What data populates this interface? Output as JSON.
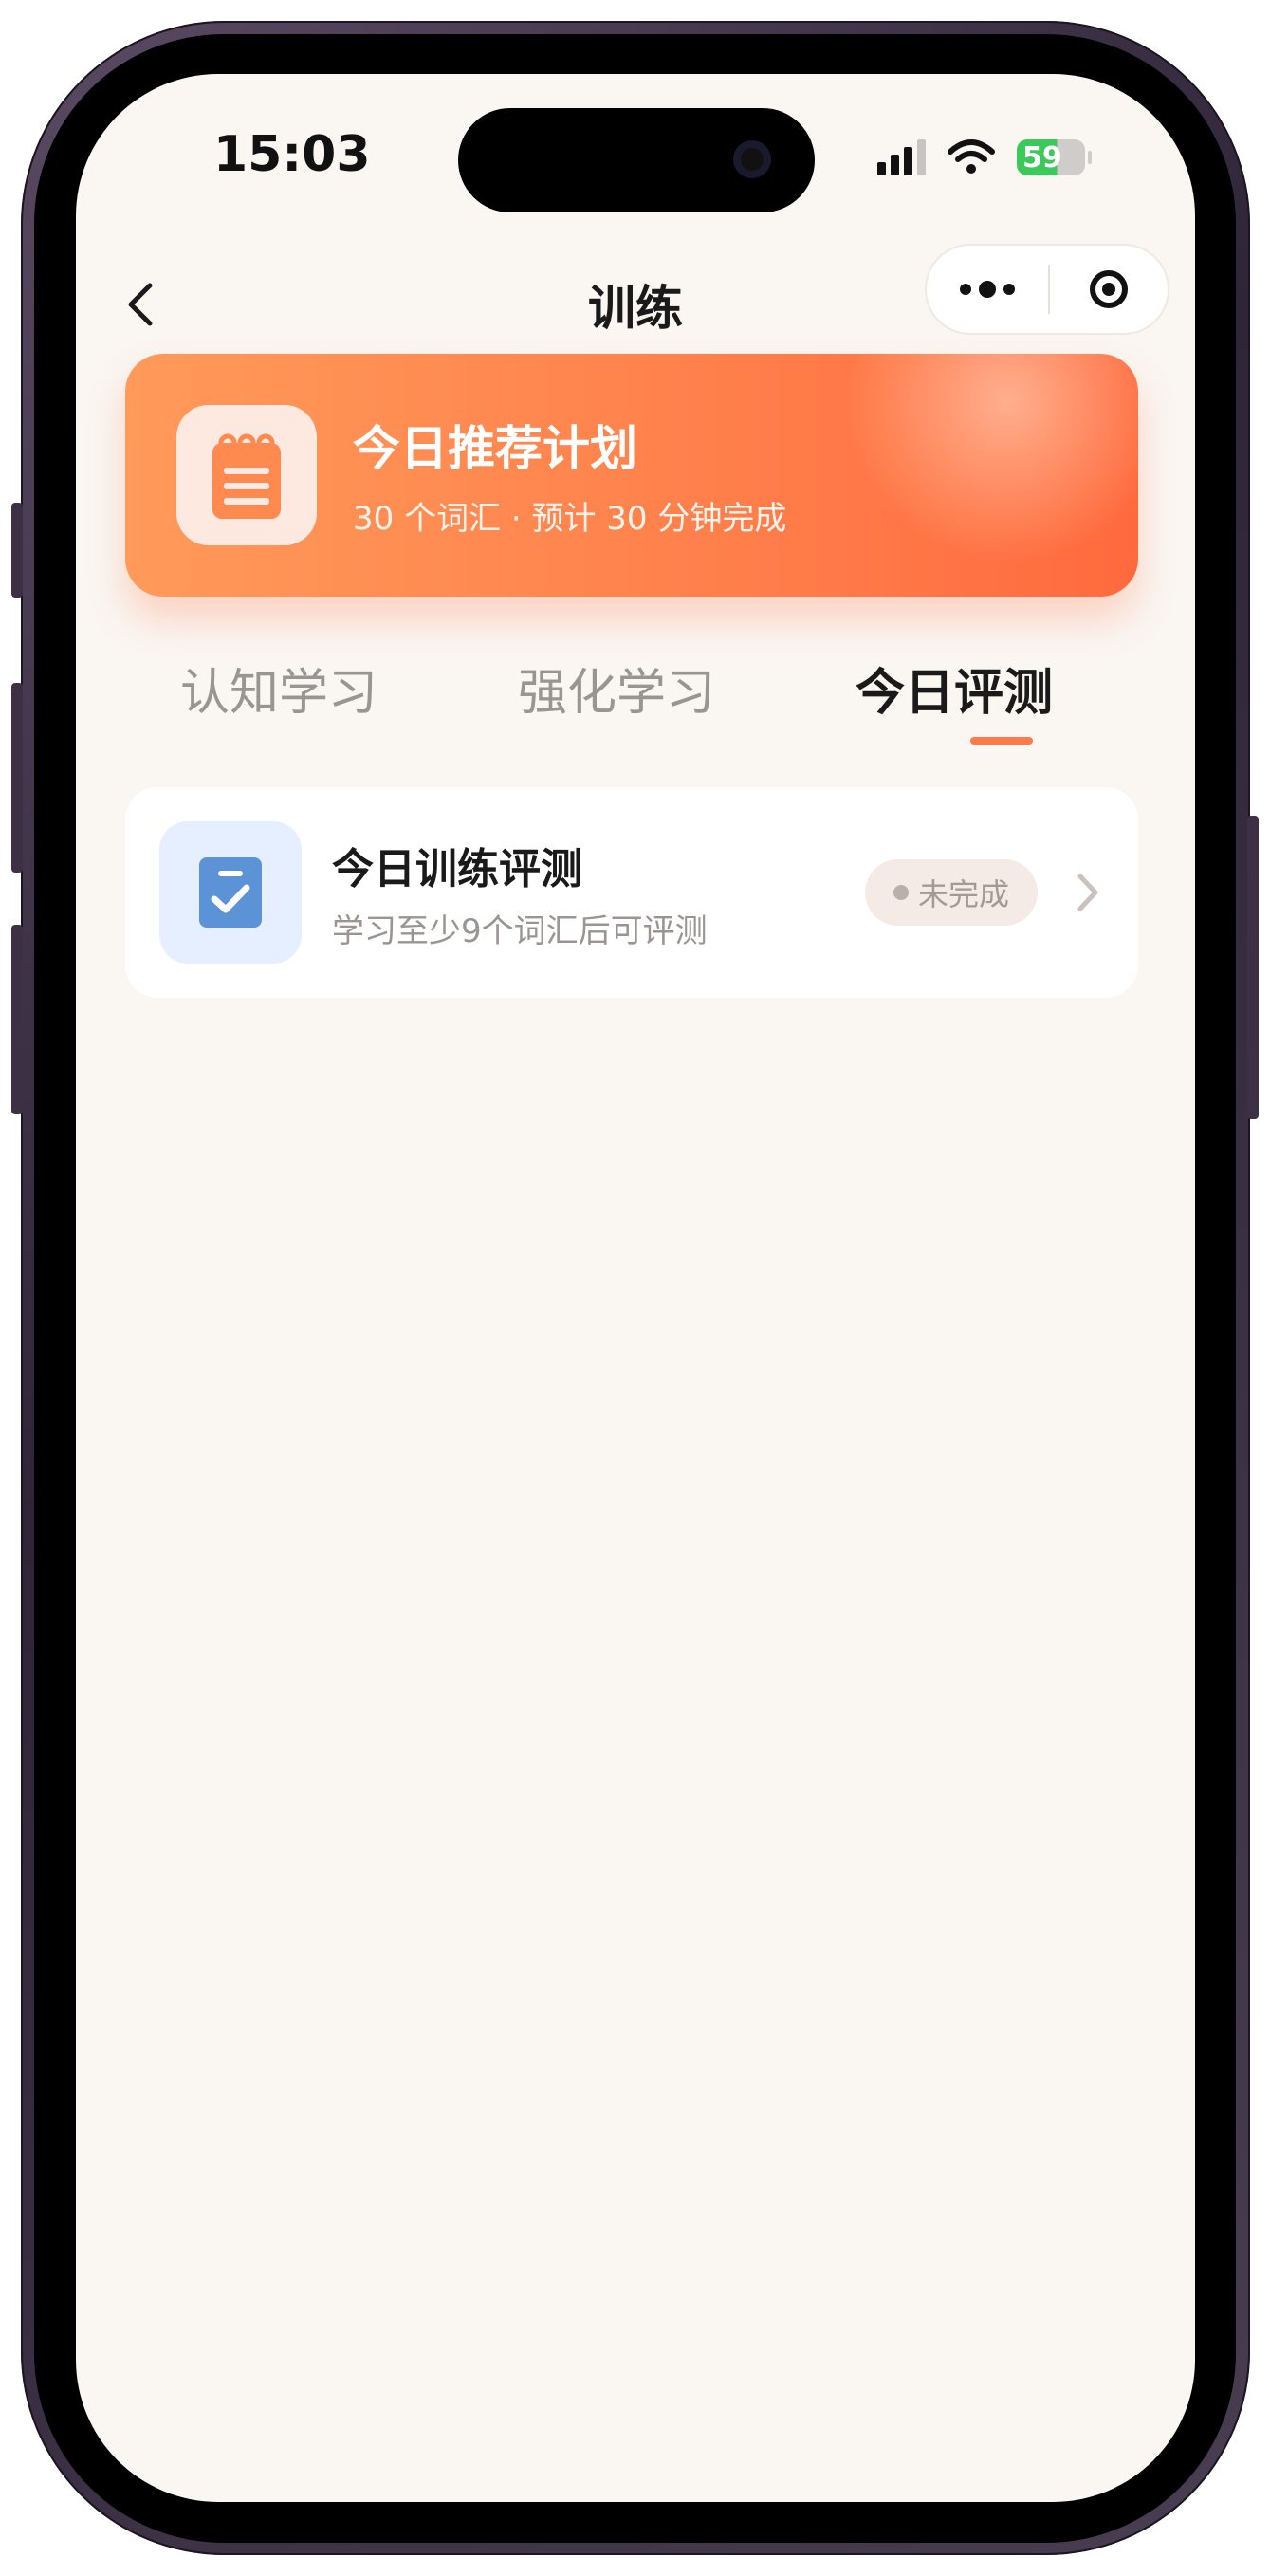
{
  "status_bar": {
    "time": "15:03",
    "battery": "59"
  },
  "nav": {
    "title": "训练",
    "back_icon": "chevron-left-icon",
    "more_icon": "more-dots-icon",
    "close_icon": "target-icon"
  },
  "plan": {
    "title": "今日推荐计划",
    "subtitle": "30 个词汇 · 预计 30 分钟完成",
    "icon": "notepad-icon"
  },
  "tabs": [
    {
      "label": "认知学习",
      "active": false
    },
    {
      "label": "强化学习",
      "active": false
    },
    {
      "label": "今日评测",
      "active": true
    }
  ],
  "eval_card": {
    "title": "今日训练评测",
    "subtitle": "学习至少9个词汇后可评测",
    "status": "未完成",
    "icon": "clipboard-check-icon"
  },
  "colors": {
    "accent": "#ff7a48",
    "background": "#faf6f2",
    "eval_icon_bg": "#e6efff",
    "eval_icon": "#5b93d6"
  }
}
